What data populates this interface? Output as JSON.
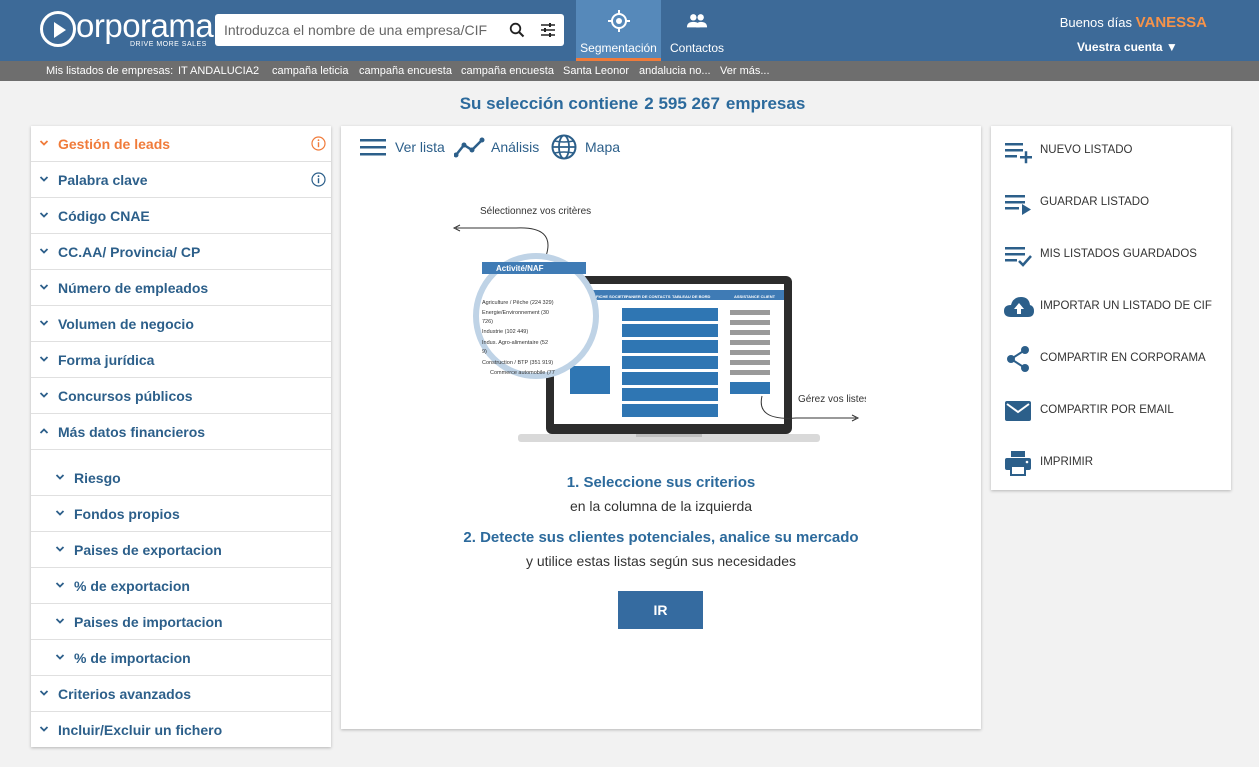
{
  "header": {
    "logo_text": "orporama",
    "logo_tagline": "DRIVE MORE SALES",
    "search_placeholder": "Introduzca el nombre de una empresa/CIF",
    "tabs": [
      {
        "label": "Segmentación",
        "icon": "target-icon",
        "active": true
      },
      {
        "label": "Contactos",
        "icon": "people-icon",
        "active": false
      }
    ],
    "greeting": "Buenos días",
    "user_name": "VANESSA",
    "account_label": "Vuestra cuenta ▼"
  },
  "subbar": {
    "label": "Mis listados de empresas:",
    "items": [
      "IT ANDALUCIA2",
      "campaña leticia",
      "campaña encuesta",
      "campaña encuesta",
      "Santa Leonor",
      "andalucia no...",
      "Ver más..."
    ]
  },
  "selection": {
    "prefix": "Su selección contiene",
    "count": "2 595 267",
    "suffix": "empresas"
  },
  "criteria": [
    {
      "label": "Gestión de leads",
      "info": true,
      "expanded": false,
      "highlight": true
    },
    {
      "label": "Palabra clave",
      "info": true,
      "expanded": false
    },
    {
      "label": "Código CNAE",
      "expanded": false
    },
    {
      "label": "CC.AA/ Provincia/ CP",
      "expanded": false
    },
    {
      "label": "Número de empleados",
      "expanded": false
    },
    {
      "label": "Volumen de negocio",
      "expanded": false
    },
    {
      "label": "Forma jurídica",
      "expanded": false
    },
    {
      "label": "Concursos públicos",
      "expanded": false
    },
    {
      "label": "Más datos financieros",
      "expanded": true
    },
    {
      "label": "Riesgo",
      "sub": true
    },
    {
      "label": "Fondos propios",
      "sub": true
    },
    {
      "label": "Paises de exportacion",
      "sub": true
    },
    {
      "label": "% de exportacion",
      "sub": true
    },
    {
      "label": "Paises de importacion",
      "sub": true
    },
    {
      "label": "% de importacion",
      "sub": true
    },
    {
      "label": "Criterios avanzados",
      "expanded": false
    },
    {
      "label": "Incluir/Excluir un fichero",
      "expanded": false
    }
  ],
  "view_tabs": [
    {
      "label": "Ver lista",
      "icon": "list-icon"
    },
    {
      "label": "Análisis",
      "icon": "chart-line-icon"
    },
    {
      "label": "Mapa",
      "icon": "globe-icon"
    }
  ],
  "illustration": {
    "caption_top": "Sélectionnez vos critères",
    "caption_right": "Gérez vos listes",
    "magnifier_header": "Activité/NAF",
    "magnifier_items": [
      "Agriculture / Pêche (224 329)",
      "Energie/Environnement (30",
      "726)",
      "Industrie (102 449)",
      "Indus. Agro-alimentaire (52",
      "9)",
      "Construction / BTP (351 919)",
      "Commerce automobile (77"
    ],
    "screen_tabs": [
      "FICHE SOCIETE",
      "PANIER DE CONTACTS",
      "TABLEAU DE BORD",
      "ASSISTANCE CLIENT"
    ]
  },
  "steps": {
    "step1_title": "1. Seleccione sus criterios",
    "step1_text": "en la columna de la izquierda",
    "step2_title": "2. Detecte sus clientes potenciales, analice su mercado",
    "step2_text": "y utilice estas listas según sus necesidades",
    "button": "IR"
  },
  "actions": [
    {
      "label": "NUEVO LISTADO",
      "icon": "playlist-add-icon"
    },
    {
      "label": "GUARDAR LISTADO",
      "icon": "playlist-play-icon"
    },
    {
      "label": "MIS LISTADOS GUARDADOS",
      "icon": "playlist-check-icon"
    },
    {
      "label": "IMPORTAR UN LISTADO DE CIF",
      "icon": "cloud-upload-icon"
    },
    {
      "label": "COMPARTIR EN CORPORAMA",
      "icon": "share-icon"
    },
    {
      "label": "COMPARTIR POR EMAIL",
      "icon": "email-icon"
    },
    {
      "label": "IMPRIMIR",
      "icon": "print-icon"
    }
  ],
  "colors": {
    "header_bg": "#3d6a98",
    "active_tab_bg": "#5689ba",
    "accent_orange": "#f07b3a",
    "text_blue": "#2c5f8a",
    "button_blue": "#356ba0"
  }
}
